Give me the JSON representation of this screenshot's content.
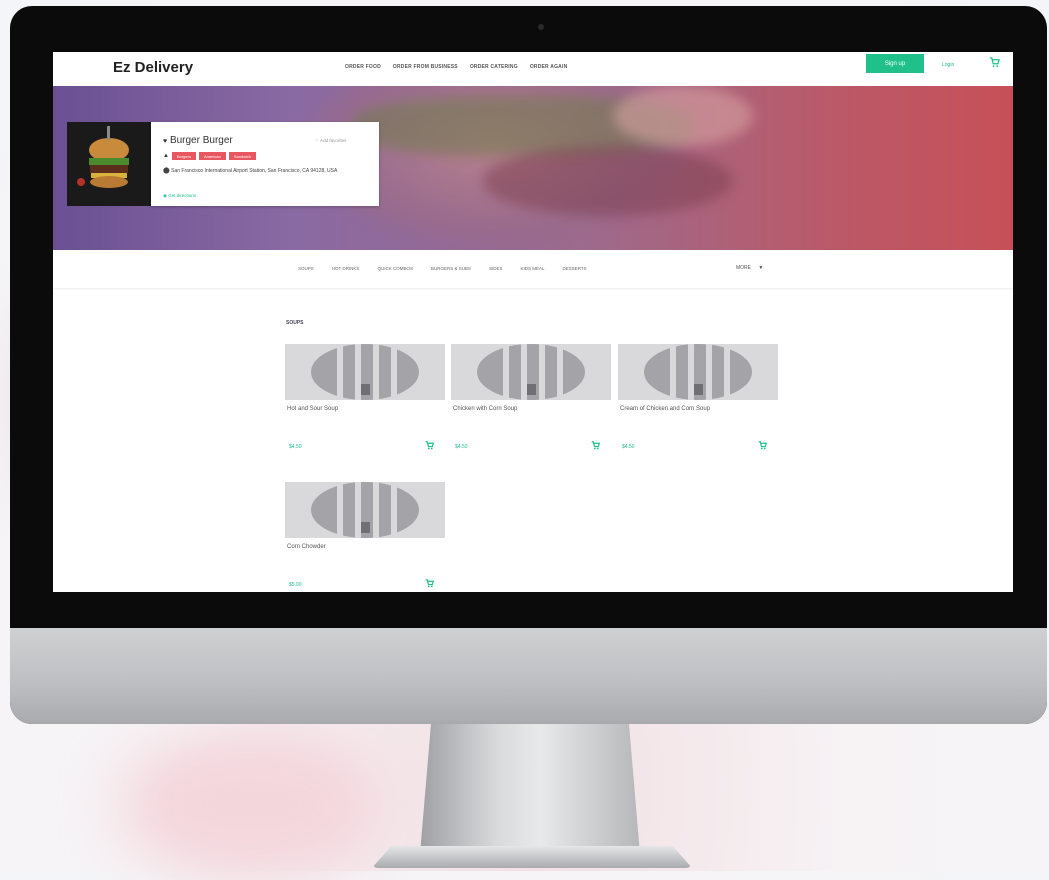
{
  "app": {
    "logo": "Ez Delivery",
    "nav": [
      "ORDER FOOD",
      "ORDER FROM BUSINESS",
      "ORDER CATERING",
      "ORDER AGAIN"
    ],
    "signup_label": "Sign up",
    "login_label": "Login"
  },
  "restaurant": {
    "name": "Burger Burger",
    "add_favorites": "Add favorites",
    "tags": [
      "Burgers",
      "American",
      "Sandwich"
    ],
    "address": "San Francisco International Airport Station, San Francisco, CA 94128, USA",
    "directions": "Get directions"
  },
  "categories": {
    "items": [
      "SOUPS",
      "HOT DRINKS",
      "QUICK COMBOS",
      "BURGERS & SUBS",
      "SIDES",
      "KIDS MEAL",
      "DESSERTS"
    ],
    "more_label": "MORE"
  },
  "menu": {
    "section_title": "SOUPS",
    "items": [
      {
        "name": "Hot and Sour Soup",
        "price": "$4.50"
      },
      {
        "name": "Chicken with Corn Soup",
        "price": "$4.50"
      },
      {
        "name": "Cream of Chicken and Corn Soup",
        "price": "$4.50"
      },
      {
        "name": "Corn Chowder",
        "price": "$5.00"
      }
    ]
  },
  "colors": {
    "accent": "#1fc08a",
    "tag": "#e8565f",
    "hero_start": "#6a5093",
    "hero_end": "#c75058"
  },
  "icons": {
    "cart": "cart-icon",
    "heart": "heart-icon",
    "pin": "location-pin-icon"
  }
}
